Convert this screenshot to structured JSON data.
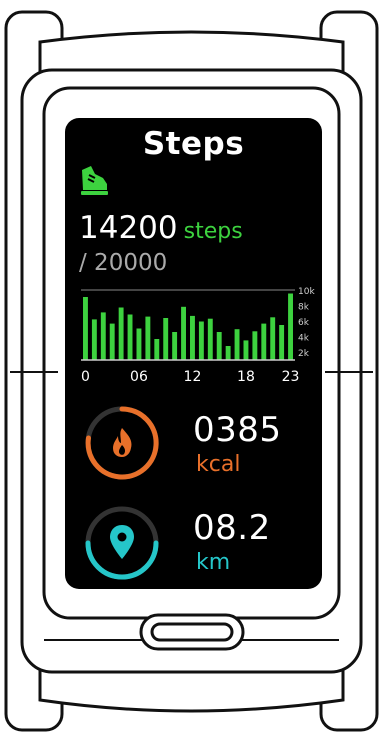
{
  "screen": {
    "title": "Steps",
    "steps_value": "14200",
    "steps_unit": "steps",
    "goal": "/ 20000",
    "calories": {
      "value": "0385",
      "unit": "kcal",
      "icon": "flame-icon",
      "color": "#e8702a"
    },
    "distance": {
      "value": "08.2",
      "unit": "km",
      "icon": "location-pin-icon",
      "color": "#25c6c9"
    }
  },
  "chart_data": {
    "type": "bar",
    "categories": [
      "0",
      "1",
      "2",
      "3",
      "4",
      "5",
      "6",
      "7",
      "8",
      "9",
      "10",
      "11",
      "12",
      "13",
      "14",
      "15",
      "16",
      "17",
      "18",
      "19",
      "20",
      "21",
      "22",
      "23"
    ],
    "values": [
      9000,
      5800,
      6800,
      5200,
      7500,
      6500,
      4500,
      6200,
      3000,
      6000,
      4000,
      7600,
      6300,
      5500,
      5900,
      4000,
      2000,
      4400,
      2800,
      4100,
      5200,
      6100,
      5000,
      9500
    ],
    "xtick_labels": [
      "0",
      "06",
      "12",
      "18",
      "23"
    ],
    "ytick_labels": [
      "10k",
      "8k",
      "6k",
      "4k",
      "2k"
    ],
    "ylim": [
      0,
      10000
    ],
    "bar_color": "#3dd23f"
  }
}
